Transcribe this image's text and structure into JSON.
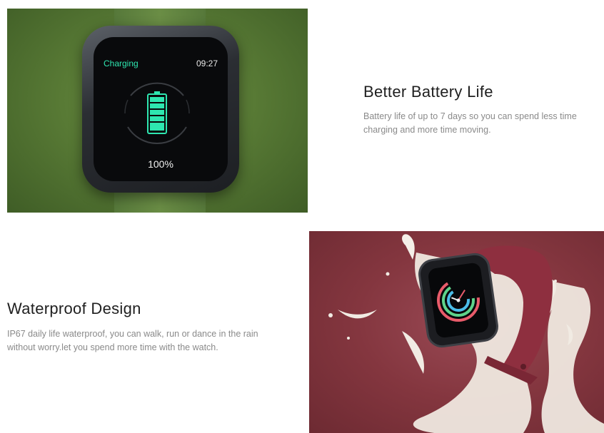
{
  "battery_section": {
    "screen_status": "Charging",
    "screen_time": "09:27",
    "screen_percent": "100%",
    "title": "Better Battery Life",
    "description": "Battery life of up to 7 days so you can spend less time charging and more time moving.",
    "icons": [
      "battery-icon"
    ],
    "colors": {
      "background": "#587a35",
      "accent": "#2ee6b0"
    }
  },
  "waterproof_section": {
    "title": "Waterproof Design",
    "description": "IP67 daily life waterproof, you can walk, run or dance in the rain without worry.let you spend more time with the watch.",
    "colors": {
      "background": "#84363f",
      "splash": "#f2ede6",
      "strap": "#8e2f3f"
    }
  }
}
